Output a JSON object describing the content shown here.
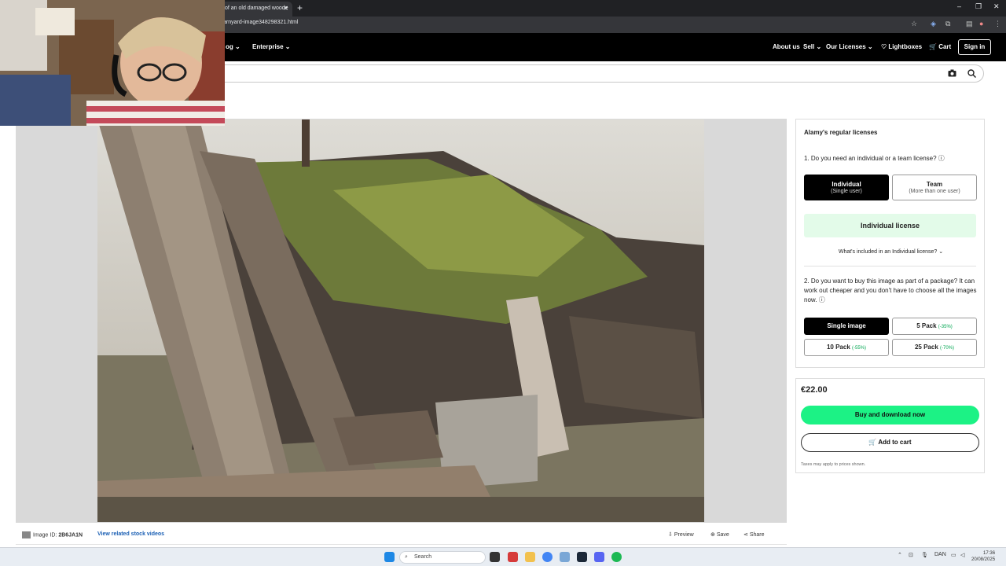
{
  "browser": {
    "tab_title": "of an old damaged woode",
    "tab_close": "✕",
    "new_tab": "+",
    "url": "arnyard-image348298321.html",
    "window_controls": [
      "–",
      "❐",
      "✕"
    ]
  },
  "site_nav": {
    "left_items": [
      "og",
      "Enterprise"
    ],
    "right_items": [
      "About us",
      "Sell",
      "Our Licenses"
    ],
    "lightboxes": "Lightboxes",
    "cart": "Cart",
    "sign_in": "Sign in"
  },
  "image_footer": {
    "image_id_label": "Image ID:",
    "image_id": "2B6JA1N",
    "related_link": "View related stock videos",
    "preview": "Preview",
    "save": "Save",
    "share": "Share"
  },
  "licenses": {
    "title": "Alamy's regular licenses",
    "q1": "1.  Do you need an individual or a team license?",
    "individual": {
      "label": "Individual",
      "sub": "(Single user)"
    },
    "team": {
      "label": "Team",
      "sub": "(More than one user)"
    },
    "banner": "Individual license",
    "whats_included": "What's included in an Individual license?",
    "q2": "2.  Do you want to buy this image as part of a package? It can work out cheaper and you don't have to choose all the images now.",
    "packages": [
      {
        "label": "Single image",
        "disc": ""
      },
      {
        "label": "5 Pack",
        "disc": "(-35%)"
      },
      {
        "label": "10 Pack",
        "disc": "(-55%)"
      },
      {
        "label": "25 Pack",
        "disc": "(-70%)"
      }
    ]
  },
  "buy": {
    "price": "€22.00",
    "buy_now": "Buy and download now",
    "add_to_cart": "Add to cart",
    "tax_note": "Taxes may apply to prices shown."
  },
  "taskbar": {
    "search": "Search",
    "lang": "DAN",
    "time": "17:36",
    "date": "20/08/2025"
  }
}
